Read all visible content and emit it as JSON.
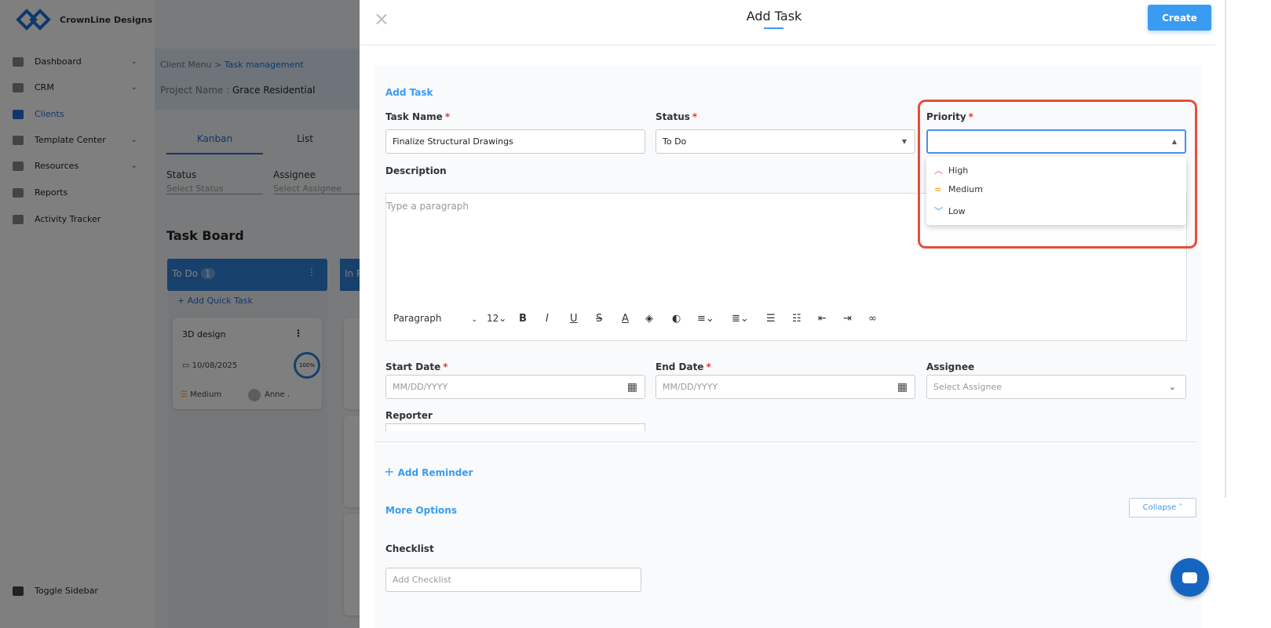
{
  "app": {
    "brand": "CrownLine Designs"
  },
  "sidebar": {
    "items": [
      {
        "label": "Dashboard"
      },
      {
        "label": "CRM"
      },
      {
        "label": "Clients"
      },
      {
        "label": "Template Center"
      },
      {
        "label": "Resources"
      },
      {
        "label": "Reports"
      },
      {
        "label": "Activity Tracker"
      }
    ],
    "toggle": "Toggle Sidebar"
  },
  "breadcrumb": {
    "parent": "Client Menu",
    "current": "Task management"
  },
  "project": {
    "label": "Project Name :",
    "name": "Grace Residential"
  },
  "views": {
    "kanban": "Kanban",
    "list": "List"
  },
  "filters": {
    "status_label": "Status",
    "status_ph": "Select Status",
    "assignee_label": "Assignee",
    "assignee_ph": "Select Assignee"
  },
  "board": {
    "title": "Task Board",
    "columns": [
      {
        "name": "To Do",
        "count": "1",
        "add": "+ Add Quick Task"
      },
      {
        "name": "In P"
      }
    ],
    "card": {
      "title": "3D design",
      "date": "10/08/2025",
      "progress": "100%",
      "priority": "Medium",
      "assignee": "Anne ."
    }
  },
  "modal": {
    "title": "Add Task",
    "create": "Create",
    "section": "Add Task",
    "task_name_label": "Task Name",
    "task_name_value": "Finalize Structural Drawings",
    "status_label": "Status",
    "status_value": "To Do",
    "priority_label": "Priority",
    "priority_options": [
      {
        "label": "High",
        "color": "#ef5350"
      },
      {
        "label": "Medium",
        "color": "#ffa726"
      },
      {
        "label": "Low",
        "color": "#2196f3"
      }
    ],
    "description_label": "Description",
    "description_ph": "Type a paragraph",
    "toolbar": {
      "block": "Paragraph",
      "size": "12"
    },
    "start_label": "Start Date",
    "end_label": "End Date",
    "date_ph": "MM/DD/YYYY",
    "assignee_label": "Assignee",
    "assignee_ph": "Select Assignee",
    "reporter_label": "Reporter",
    "add_reminder": "Add Reminder",
    "more_options": "More Options",
    "collapse": "Collapse",
    "checklist_label": "Checklist",
    "checklist_ph": "Add Checklist"
  },
  "colors": {
    "accent": "#3a9bf2",
    "highlight": "#e74c3c"
  }
}
